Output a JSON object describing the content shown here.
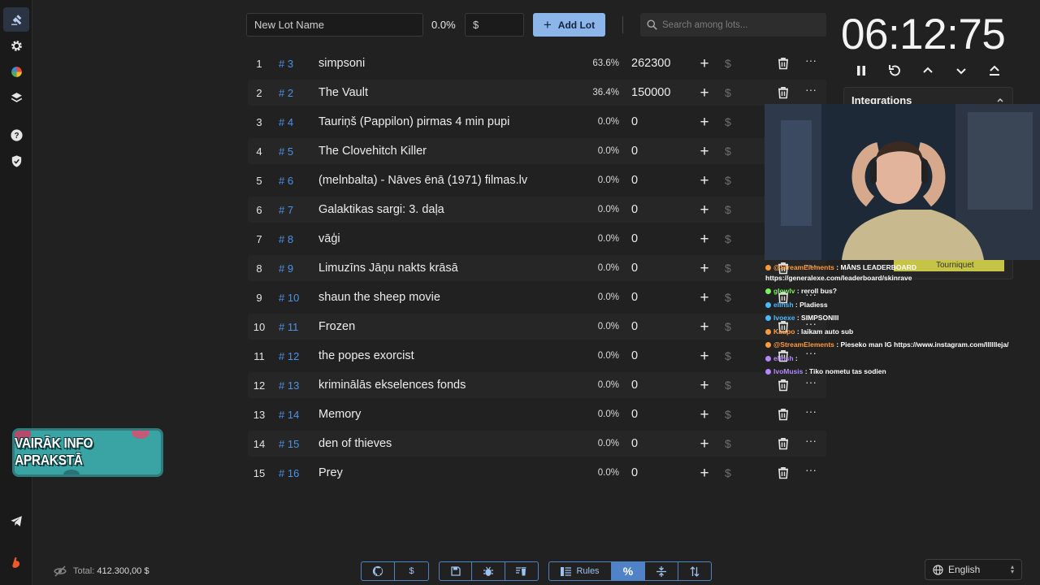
{
  "toolbar": {
    "lot_name_placeholder": "New Lot Name",
    "percent": "0.0%",
    "amount_placeholder": "$",
    "add_lot_label": "Add Lot",
    "search_placeholder": "Search among lots..."
  },
  "lots": [
    {
      "index": "1",
      "id": "# 3",
      "name": "simpsoni",
      "percent": "63.6%",
      "amount": "262300"
    },
    {
      "index": "2",
      "id": "# 2",
      "name": "The Vault",
      "percent": "36.4%",
      "amount": "150000"
    },
    {
      "index": "3",
      "id": "# 4",
      "name": "Tauriņš (Pappilon) pirmas 4 min pupi",
      "percent": "0.0%",
      "amount": "0"
    },
    {
      "index": "4",
      "id": "# 5",
      "name": "The Clovehitch Killer",
      "percent": "0.0%",
      "amount": "0"
    },
    {
      "index": "5",
      "id": "# 6",
      "name": "(melnbalta) - Nāves ēnā (1971) filmas.lv",
      "percent": "0.0%",
      "amount": "0"
    },
    {
      "index": "6",
      "id": "# 7",
      "name": "Galaktikas sargi: 3. daļa",
      "percent": "0.0%",
      "amount": "0"
    },
    {
      "index": "7",
      "id": "# 8",
      "name": "vāģi",
      "percent": "0.0%",
      "amount": "0"
    },
    {
      "index": "8",
      "id": "# 9",
      "name": "Limuzīns Jāņu nakts krāsā",
      "percent": "0.0%",
      "amount": "0"
    },
    {
      "index": "9",
      "id": "# 10",
      "name": "shaun the sheep movie",
      "percent": "0.0%",
      "amount": "0"
    },
    {
      "index": "10",
      "id": "# 11",
      "name": "Frozen",
      "percent": "0.0%",
      "amount": "0"
    },
    {
      "index": "11",
      "id": "# 12",
      "name": "the popes exorcist",
      "percent": "0.0%",
      "amount": "0"
    },
    {
      "index": "12",
      "id": "# 13",
      "name": "kriminālās ekselences fonds",
      "percent": "0.0%",
      "amount": "0"
    },
    {
      "index": "13",
      "id": "# 14",
      "name": "Memory",
      "percent": "0.0%",
      "amount": "0"
    },
    {
      "index": "14",
      "id": "# 15",
      "name": "den of thieves",
      "percent": "0.0%",
      "amount": "0"
    },
    {
      "index": "15",
      "id": "# 16",
      "name": "Prey",
      "percent": "0.0%",
      "amount": "0"
    }
  ],
  "lot_dollar_symbol": "$",
  "lot_more_symbol": "···",
  "timer": {
    "display": "06:12:75"
  },
  "integrations": {
    "title": "Integrations",
    "tourniquet": "Tourniquet"
  },
  "chat": [
    {
      "user": "@StreamElements",
      "color": "#ff9a3c",
      "message": " : MĀNS LEADERBOARD"
    },
    {
      "user": "",
      "color": "#ffffff",
      "message": "https://generalexe.com/leaderboard/skinrave"
    },
    {
      "user": "glowlv",
      "color": "#7cf05e",
      "message": " : reroll bus?"
    },
    {
      "user": "elinsh",
      "color": "#4cb8ff",
      "message": " : Pladiess"
    },
    {
      "user": "Ivoexe",
      "color": "#4cb8ff",
      "message": " : SIMPSONIII"
    },
    {
      "user": "Kaupo",
      "color": "#ff9a3c",
      "message": " : laikam auto sub"
    },
    {
      "user": "@StreamElements",
      "color": "#ff9a3c",
      "message": " : Pieseko man IG https://www.instagram.com/lllllleja/"
    },
    {
      "user": "elinsh",
      "color": "#b388ff",
      "message": " : "
    },
    {
      "user": "IvoMusis",
      "color": "#b388ff",
      "message": " : Tiko nometu tas sodien"
    }
  ],
  "promo": {
    "text": "VAIRĀK INFO APRAKSTĀ"
  },
  "footer": {
    "total_label": "Total:",
    "total_value": "412.300,00 $",
    "rules_label": "Rules",
    "dollar": "$",
    "percent_symbol": "%",
    "language": "English"
  },
  "colors": {
    "accent": "#8cb6ea",
    "id_blue": "#4c93e6",
    "background": "#212121"
  }
}
